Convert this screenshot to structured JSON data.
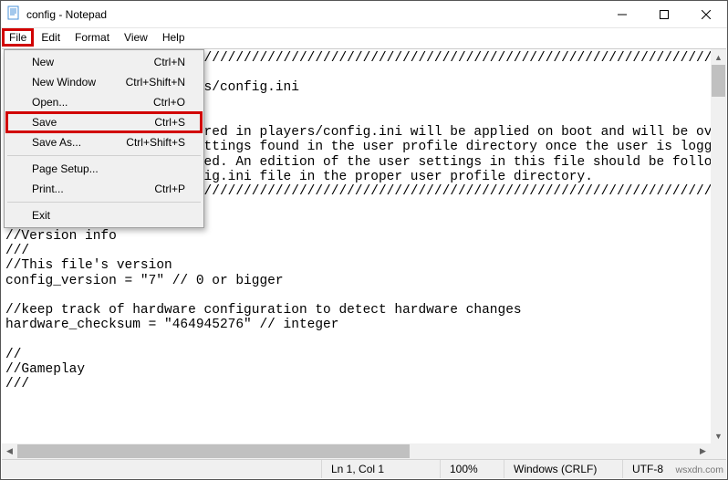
{
  "title": "config - Notepad",
  "menubar": {
    "file": "File",
    "edit": "Edit",
    "format": "Format",
    "view": "View",
    "help": "Help"
  },
  "dropdown": {
    "new_label": "New",
    "new_short": "Ctrl+N",
    "newwin_label": "New Window",
    "newwin_short": "Ctrl+Shift+N",
    "open_label": "Open...",
    "open_short": "Ctrl+O",
    "save_label": "Save",
    "save_short": "Ctrl+S",
    "saveas_label": "Save As...",
    "saveas_short": "Ctrl+Shift+S",
    "pagesetup_label": "Page Setup...",
    "print_label": "Print...",
    "print_short": "Ctrl+P",
    "exit_label": "Exit"
  },
  "editor_lines": [
    "//////////////////////////////////////////////////////////////////////////////////////////////////",
    "///",
    "///player profile: players/config.ini",
    "///",
    "///",
    "///These settings are stored in players/config.ini will be applied on boot and will be overridden.",
    "///by any user profile settings found in the user profile directory once the user is logged in",
    "///and their profile loaded. An edition of the user settings in this file should be followed by",
    "///a copy of the new config.ini file in the proper user profile directory.",
    "//////////////////////////////////////////////////////////////////////////////////////////////////",
    "",
    "//",
    "//Version info",
    "///",
    "//This file's version",
    "config_version = \"7\" // 0 or bigger",
    "",
    "//keep track of hardware configuration to detect hardware changes",
    "hardware_checksum = \"464945276\" // integer",
    "",
    "//",
    "//Gameplay",
    "///"
  ],
  "status": {
    "pos": "Ln 1, Col 1",
    "zoom": "100%",
    "eol": "Windows (CRLF)",
    "encoding": "UTF-8"
  },
  "watermark": "wsxdn.com"
}
